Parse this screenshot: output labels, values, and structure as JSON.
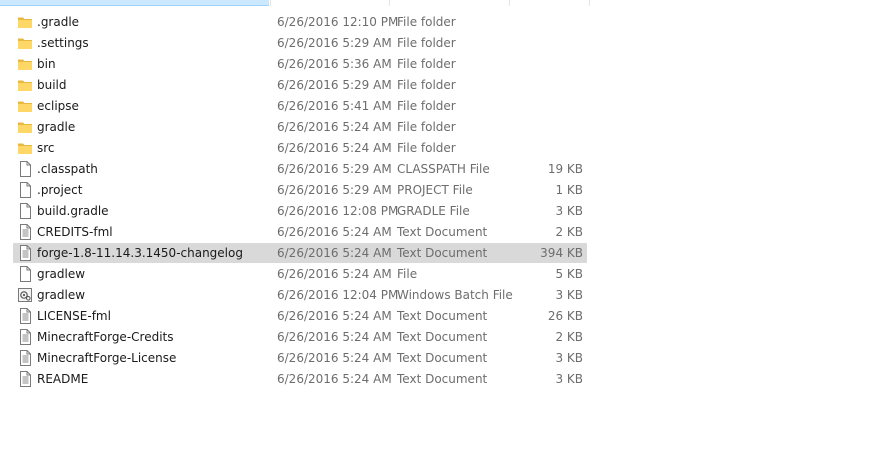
{
  "files": [
    {
      "name": ".gradle",
      "date": "6/26/2016 12:10 PM",
      "type": "File folder",
      "size": "",
      "icon": "folder-icon"
    },
    {
      "name": ".settings",
      "date": "6/26/2016 5:29 AM",
      "type": "File folder",
      "size": "",
      "icon": "folder-icon"
    },
    {
      "name": "bin",
      "date": "6/26/2016 5:36 AM",
      "type": "File folder",
      "size": "",
      "icon": "folder-icon"
    },
    {
      "name": "build",
      "date": "6/26/2016 5:29 AM",
      "type": "File folder",
      "size": "",
      "icon": "folder-icon"
    },
    {
      "name": "eclipse",
      "date": "6/26/2016 5:41 AM",
      "type": "File folder",
      "size": "",
      "icon": "folder-icon"
    },
    {
      "name": "gradle",
      "date": "6/26/2016 5:24 AM",
      "type": "File folder",
      "size": "",
      "icon": "folder-icon"
    },
    {
      "name": "src",
      "date": "6/26/2016 5:24 AM",
      "type": "File folder",
      "size": "",
      "icon": "folder-icon"
    },
    {
      "name": ".classpath",
      "date": "6/26/2016 5:29 AM",
      "type": "CLASSPATH File",
      "size": "19 KB",
      "icon": "blank-file-icon"
    },
    {
      "name": ".project",
      "date": "6/26/2016 5:29 AM",
      "type": "PROJECT File",
      "size": "1 KB",
      "icon": "blank-file-icon"
    },
    {
      "name": "build.gradle",
      "date": "6/26/2016 12:08 PM",
      "type": "GRADLE File",
      "size": "3 KB",
      "icon": "blank-file-icon"
    },
    {
      "name": "CREDITS-fml",
      "date": "6/26/2016 5:24 AM",
      "type": "Text Document",
      "size": "2 KB",
      "icon": "text-document-icon"
    },
    {
      "name": "forge-1.8-11.14.3.1450-changelog",
      "date": "6/26/2016 5:24 AM",
      "type": "Text Document",
      "size": "394 KB",
      "icon": "text-document-icon",
      "selected": true
    },
    {
      "name": "gradlew",
      "date": "6/26/2016 5:24 AM",
      "type": "File",
      "size": "5 KB",
      "icon": "blank-file-icon"
    },
    {
      "name": "gradlew",
      "date": "6/26/2016 12:04 PM",
      "type": "Windows Batch File",
      "size": "3 KB",
      "icon": "batch-file-icon"
    },
    {
      "name": "LICENSE-fml",
      "date": "6/26/2016 5:24 AM",
      "type": "Text Document",
      "size": "26 KB",
      "icon": "text-document-icon"
    },
    {
      "name": "MinecraftForge-Credits",
      "date": "6/26/2016 5:24 AM",
      "type": "Text Document",
      "size": "2 KB",
      "icon": "text-document-icon"
    },
    {
      "name": "MinecraftForge-License",
      "date": "6/26/2016 5:24 AM",
      "type": "Text Document",
      "size": "3 KB",
      "icon": "text-document-icon"
    },
    {
      "name": "README",
      "date": "6/26/2016 5:24 AM",
      "type": "Text Document",
      "size": "3 KB",
      "icon": "text-document-icon"
    }
  ],
  "colors": {
    "folder": "#ffd766",
    "selected_row": "#d9d9d9",
    "secondary_text": "#6d6d6d",
    "header_selected": "#cce8ff"
  }
}
